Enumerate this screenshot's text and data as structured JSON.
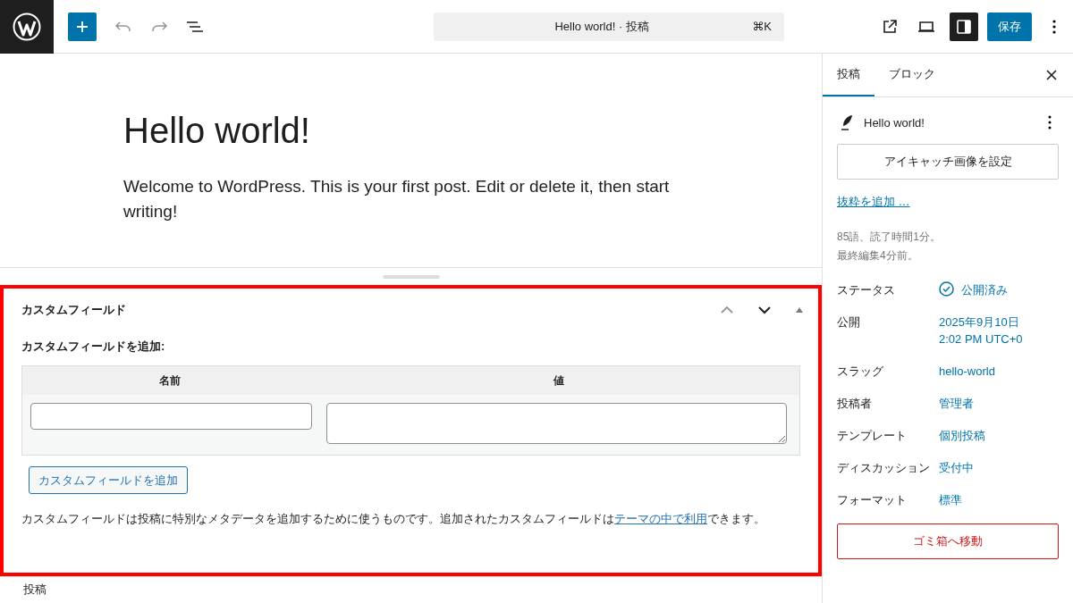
{
  "toolbar": {
    "search": {
      "title": "Hello world! · 投稿",
      "shortcut": "⌘K"
    },
    "sidebar_toggle_on": true,
    "save_button": "保存"
  },
  "post": {
    "title": "Hello world!",
    "body": "Welcome to WordPress. This is your first post. Edit or delete it, then start writing!"
  },
  "meta_box": {
    "highlighted": true,
    "title": "カスタムフィールド",
    "add_label": "カスタムフィールドを追加:",
    "columns": [
      "名前",
      "値"
    ],
    "add_button": "カスタムフィールドを追加",
    "description": "カスタムフィールドは投稿に特別なメタデータを追加するために使うものです。追加されたカスタムフィールドは",
    "description_link": "テーマの中で利用",
    "description_end": "できます。"
  },
  "footer": {
    "breadcrumb": "投稿"
  },
  "sidebar": {
    "tabs": [
      {
        "label": "投稿",
        "selected": true
      },
      {
        "label": "ブロック",
        "selected": false
      }
    ],
    "post_title": "Hello world!",
    "featured_button": "アイキャッチ画像を設定",
    "excerpt_link": "抜粋を追加 …",
    "stats": [
      "85語、読了時間1分。",
      "最終編集4分前。"
    ],
    "rows": [
      {
        "label": "ステータス",
        "value": "公開済み",
        "kind": "status"
      },
      {
        "label": "公開",
        "value": "2025年9月10日\n2:02 PM UTC+0",
        "kind": "link"
      },
      {
        "label": "スラッグ",
        "value": "hello-world",
        "kind": "link"
      },
      {
        "label": "投稿者",
        "value": "管理者",
        "kind": "link"
      },
      {
        "label": "テンプレート",
        "value": "個別投稿",
        "kind": "link"
      },
      {
        "label": "ディスカッション",
        "value": "受付中",
        "kind": "link"
      },
      {
        "label": "フォーマット",
        "value": "標準",
        "kind": "link"
      }
    ],
    "trash_button": "ゴミ箱へ移動"
  }
}
